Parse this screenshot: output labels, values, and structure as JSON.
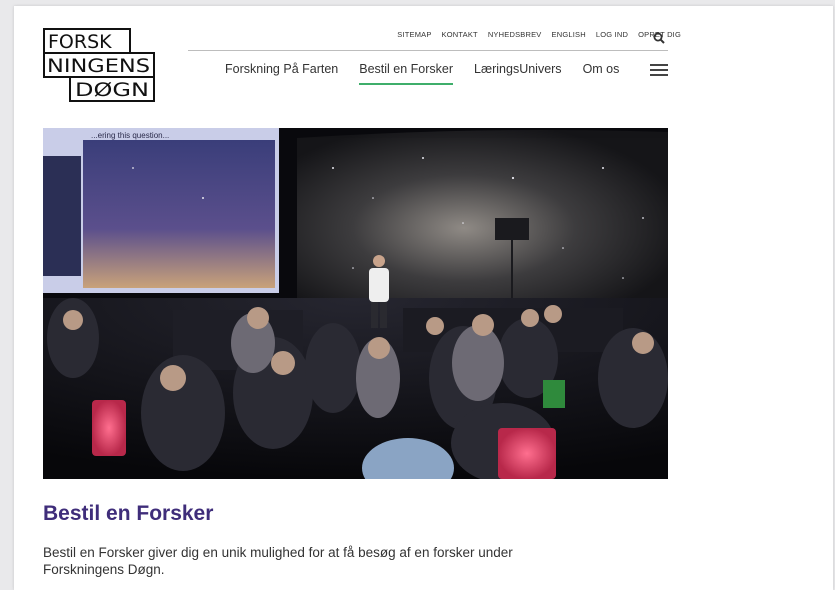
{
  "logo": {
    "line1": "FORSK",
    "line2": "NINGENS",
    "line3": "DØGN"
  },
  "utility_nav": [
    "SITEMAP",
    "KONTAKT",
    "NYHEDSBREV",
    "ENGLISH",
    "LOG IND",
    "OPRET DIG"
  ],
  "main_nav": [
    {
      "label": "Forskning På Farten",
      "active": false
    },
    {
      "label": "Bestil en Forsker",
      "active": true
    },
    {
      "label": "LæringsUnivers",
      "active": false
    },
    {
      "label": "Om os",
      "active": false
    }
  ],
  "hero": {
    "screen_text": "...ering this question..."
  },
  "content": {
    "heading": "Bestil en Forsker",
    "body": "Bestil en Forsker giver dig en unik mulighed for at få besøg af en forsker under Forskningens Døgn."
  },
  "colors": {
    "accent_green": "#3fae6b",
    "heading_purple": "#3f2d7a"
  }
}
